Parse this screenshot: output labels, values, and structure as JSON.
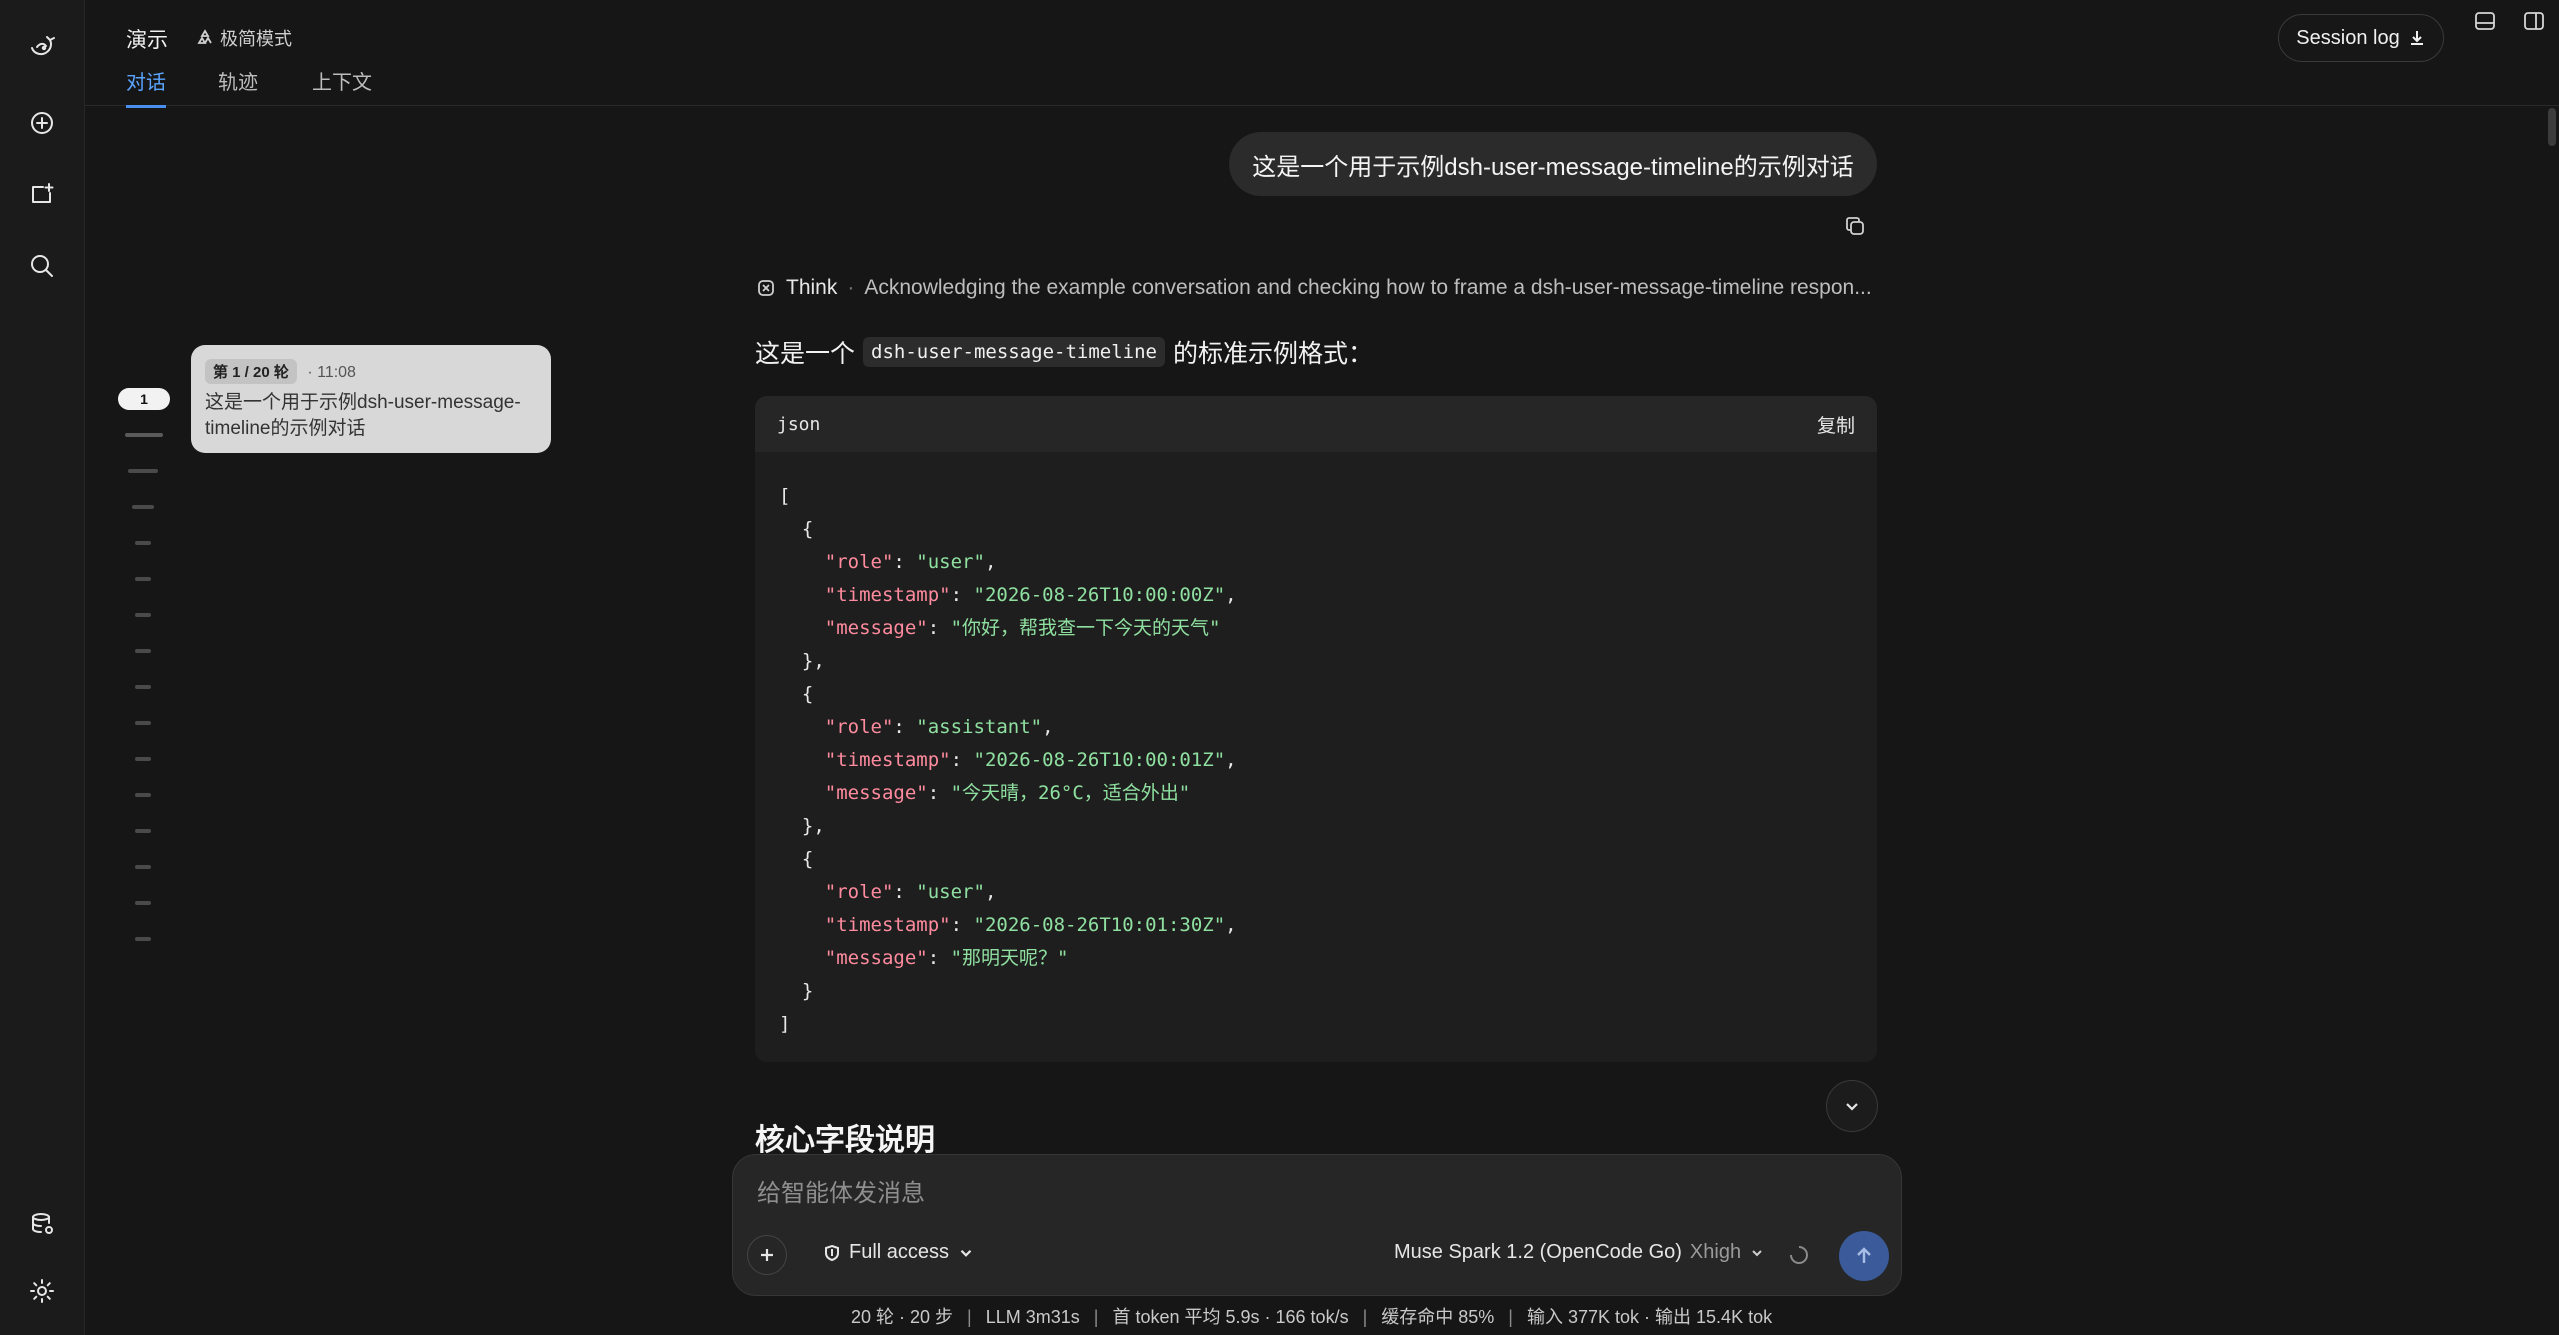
{
  "header": {
    "project": "演示",
    "mode_label": "极简模式",
    "tabs": [
      {
        "label": "对话",
        "active": true
      },
      {
        "label": "轨迹",
        "active": false
      },
      {
        "label": "上下文",
        "active": false
      }
    ],
    "session_log_label": "Session log"
  },
  "rail": {
    "icons": [
      "logo-icon",
      "new-chat-icon",
      "new-project-icon",
      "search-icon",
      "database-icon",
      "settings-icon"
    ]
  },
  "timeline": {
    "active_index": "1",
    "card": {
      "chip": "第 1 / 20 轮",
      "time": "· 11:08",
      "text": "这是一个用于示例dsh-user-message-timeline的示例对话"
    }
  },
  "chat": {
    "user_message": "这是一个用于示例dsh-user-message-timeline的示例对话",
    "think": {
      "label": "Think",
      "summary": "Acknowledging the example conversation and checking how to frame a dsh-user-message-timeline respon..."
    },
    "lead_prefix": "这是一个",
    "lead_code": "dsh-user-message-timeline",
    "lead_suffix": "的标准示例格式：",
    "code_block": {
      "language": "json",
      "copy_label": "复制",
      "entries": [
        {
          "role": "user",
          "timestamp": "2026-08-26T10:00:00Z",
          "message": "你好，帮我查一下今天的天气"
        },
        {
          "role": "assistant",
          "timestamp": "2026-08-26T10:00:01Z",
          "message": "今天晴，26°C，适合外出"
        },
        {
          "role": "user",
          "timestamp": "2026-08-26T10:01:30Z",
          "message": "那明天呢？"
        }
      ]
    },
    "section_heading": "核心字段说明"
  },
  "composer": {
    "placeholder": "给智能体发消息",
    "access_label": "Full access",
    "model_name": "Muse Spark 1.2 (OpenCode Go)",
    "effort": "Xhigh"
  },
  "status_bar": [
    "20 轮 · 20 步",
    "LLM 3m31s",
    "首 token 平均 5.9s · 166 tok/s",
    "缓存命中 85%",
    "输入 377K tok · 输出 15.4K tok"
  ],
  "colors": {
    "accent": "#4a8fef",
    "background": "#161616",
    "code_key": "#ff8b9e",
    "code_string": "#8fe0a0"
  }
}
